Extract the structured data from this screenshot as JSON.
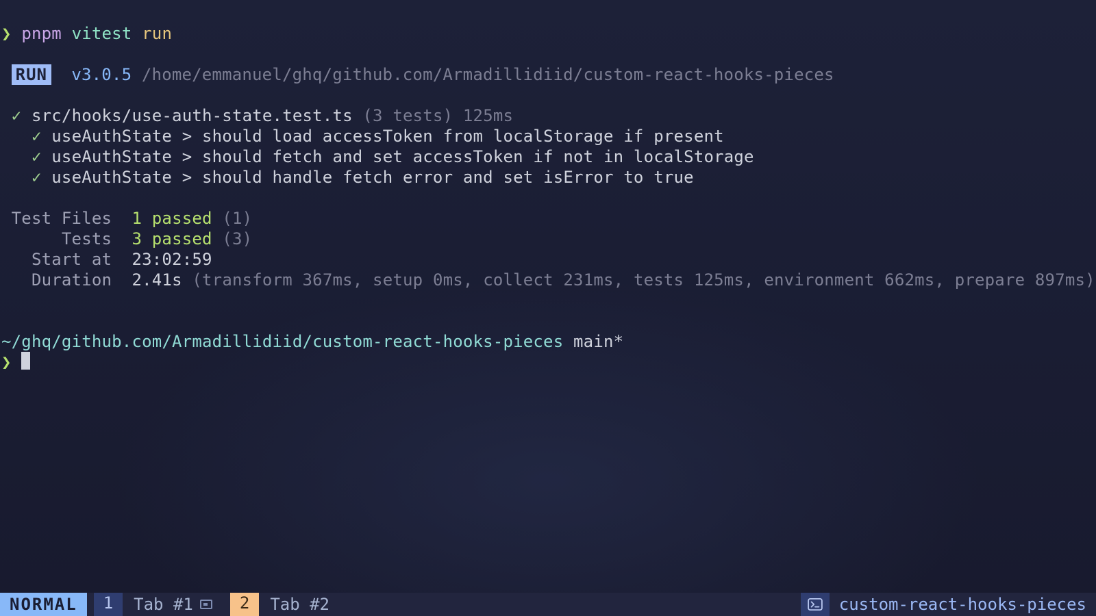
{
  "prompt": {
    "symbol": "❯",
    "keyword": "pnpm",
    "command": "vitest",
    "flag": "run"
  },
  "runner": {
    "badge": "RUN",
    "version": "v3.0.5",
    "cwd": "/home/emmanuel/ghq/github.com/Armadillidiid/custom-react-hooks-pieces"
  },
  "test_file": {
    "check": "✓",
    "path": "src/hooks/use-auth-state.test.ts",
    "count": "(3 tests)",
    "time": "125ms"
  },
  "tests": [
    {
      "check": "✓",
      "text": "useAuthState > should load accessToken from localStorage if present"
    },
    {
      "check": "✓",
      "text": "useAuthState > should fetch and set accessToken if not in localStorage"
    },
    {
      "check": "✓",
      "text": "useAuthState > should handle fetch error and set isError to true"
    }
  ],
  "summary": {
    "files_label": "Test Files",
    "files_pass": "1 passed",
    "files_total": "(1)",
    "tests_label": "Tests",
    "tests_pass": "3 passed",
    "tests_total": "(3)",
    "start_label": "Start at",
    "start_time": "23:02:59",
    "duration_label": "Duration",
    "duration_value": "2.41s",
    "duration_breakdown": "(transform 367ms, setup 0ms, collect 231ms, tests 125ms, environment 662ms, prepare 897ms)"
  },
  "shell_prompt": {
    "cwd": "~/ghq/github.com/Armadillidiid/custom-react-hooks-pieces",
    "branch": "main*",
    "symbol": "❯"
  },
  "statusbar": {
    "mode": "NORMAL",
    "tabs": [
      {
        "num": "1",
        "name": "Tab #1",
        "active": false,
        "icon": true
      },
      {
        "num": "2",
        "name": "Tab #2",
        "active": true,
        "icon": false
      }
    ],
    "project": "custom-react-hooks-pieces"
  }
}
